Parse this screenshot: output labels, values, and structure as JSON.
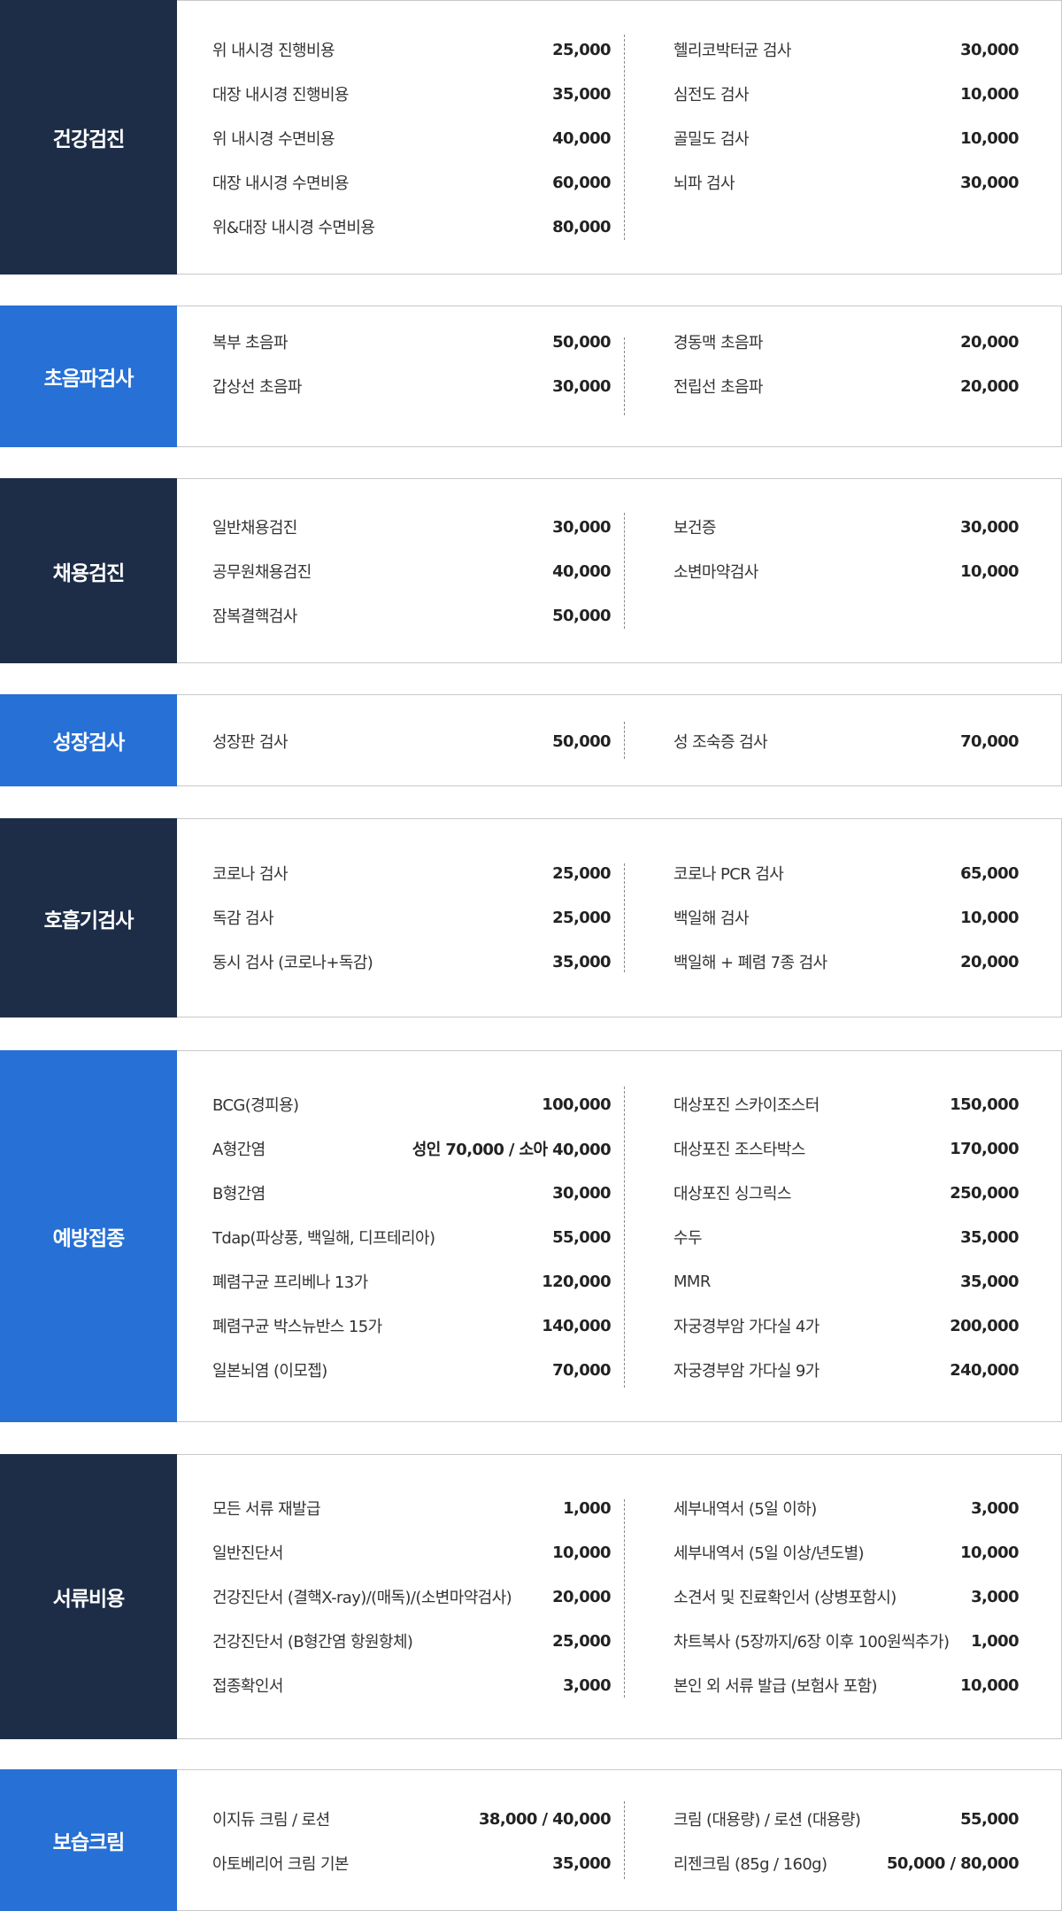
{
  "sections": [
    {
      "title": "건강검진",
      "left": [
        {
          "name": "위 내시경 진행비용",
          "price": "25,000"
        },
        {
          "name": "대장 내시경 진행비용",
          "price": "35,000"
        },
        {
          "name": "위 내시경 수면비용",
          "price": "40,000"
        },
        {
          "name": "대장 내시경 수면비용",
          "price": "60,000"
        },
        {
          "name": "위&대장 내시경 수면비용",
          "price": "80,000"
        }
      ],
      "right": [
        {
          "name": "헬리코박터균 검사",
          "price": "30,000"
        },
        {
          "name": "심전도 검사",
          "price": "10,000"
        },
        {
          "name": "골밀도 검사",
          "price": "10,000"
        },
        {
          "name": "뇌파 검사",
          "price": "30,000"
        }
      ]
    },
    {
      "title": "초음파검사",
      "left": [
        {
          "name": "복부 초음파",
          "price": "50,000"
        },
        {
          "name": "갑상선 초음파",
          "price": "30,000"
        }
      ],
      "right": [
        {
          "name": "경동맥 초음파",
          "price": "20,000"
        },
        {
          "name": "전립선 초음파",
          "price": "20,000"
        }
      ]
    },
    {
      "title": "채용검진",
      "left": [
        {
          "name": "일반채용검진",
          "price": "30,000"
        },
        {
          "name": "공무원채용검진",
          "price": "40,000"
        },
        {
          "name": "잠복결핵검사",
          "price": "50,000"
        }
      ],
      "right": [
        {
          "name": "보건증",
          "price": "30,000"
        },
        {
          "name": "소변마약검사",
          "price": "10,000"
        }
      ]
    },
    {
      "title": "성장검사",
      "left": [
        {
          "name": "성장판 검사",
          "price": "50,000"
        }
      ],
      "right": [
        {
          "name": "성 조숙증 검사",
          "price": "70,000"
        }
      ]
    },
    {
      "title": "호흡기검사",
      "left": [
        {
          "name": "코로나 검사",
          "price": "25,000"
        },
        {
          "name": "독감 검사",
          "price": "25,000"
        },
        {
          "name": "동시 검사 (코로나+독감)",
          "price": "35,000"
        }
      ],
      "right": [
        {
          "name": "코로나 PCR 검사",
          "price": "65,000"
        },
        {
          "name": "백일해 검사",
          "price": "10,000"
        },
        {
          "name": "백일해 + 폐렴 7종 검사",
          "price": "20,000"
        }
      ]
    },
    {
      "title": "예방접종",
      "left": [
        {
          "name": "BCG(경피용)",
          "price": "100,000"
        },
        {
          "name": "A형간염",
          "price": "성인 70,000 / 소아 40,000"
        },
        {
          "name": "B형간염",
          "price": "30,000"
        },
        {
          "name": "Tdap(파상풍, 백일해, 디프테리아)",
          "price": "55,000"
        },
        {
          "name": "폐렴구균 프리베나 13가",
          "price": "120,000"
        },
        {
          "name": "폐렴구균 박스뉴반스 15가",
          "price": "140,000"
        },
        {
          "name": "일본뇌염 (이모젭)",
          "price": "70,000"
        }
      ],
      "right": [
        {
          "name": "대상포진 스카이조스터",
          "price": "150,000"
        },
        {
          "name": "대상포진 조스타박스",
          "price": "170,000"
        },
        {
          "name": "대상포진 싱그릭스",
          "price": "250,000"
        },
        {
          "name": "수두",
          "price": "35,000"
        },
        {
          "name": "MMR",
          "price": "35,000"
        },
        {
          "name": "자궁경부암 가다실 4가",
          "price": "200,000"
        },
        {
          "name": "자궁경부암 가다실 9가",
          "price": "240,000"
        }
      ]
    },
    {
      "title": "서류비용",
      "left": [
        {
          "name": "모든 서류 재발급",
          "price": "1,000"
        },
        {
          "name": "일반진단서",
          "price": "10,000"
        },
        {
          "name": "건강진단서 (결핵X-ray)/(매독)/(소변마약검사)",
          "price": "20,000"
        },
        {
          "name": "건강진단서 (B형간염 항원항체)",
          "price": "25,000"
        },
        {
          "name": "접종확인서",
          "price": "3,000"
        }
      ],
      "right": [
        {
          "name": "세부내역서 (5일 이하)",
          "price": "3,000"
        },
        {
          "name": "세부내역서 (5일 이상/년도별)",
          "price": "10,000"
        },
        {
          "name": "소견서 및 진료확인서 (상병포함시)",
          "price": "3,000"
        },
        {
          "name": "차트복사 (5장까지/6장 이후 100원씩추가)",
          "price": "1,000"
        },
        {
          "name": "본인 외 서류 발급 (보험사 포함)",
          "price": "10,000"
        }
      ]
    },
    {
      "title": "보습크림",
      "left": [
        {
          "name": "이지듀 크림 / 로션",
          "price": "38,000 / 40,000"
        },
        {
          "name": "아토베리어 크림 기본",
          "price": "35,000"
        }
      ],
      "right": [
        {
          "name": "크림 (대용량) / 로션 (대용량)",
          "price": "55,000"
        },
        {
          "name": "리젠크림 (85g / 160g)",
          "price": "50,000 / 80,000"
        }
      ]
    }
  ]
}
